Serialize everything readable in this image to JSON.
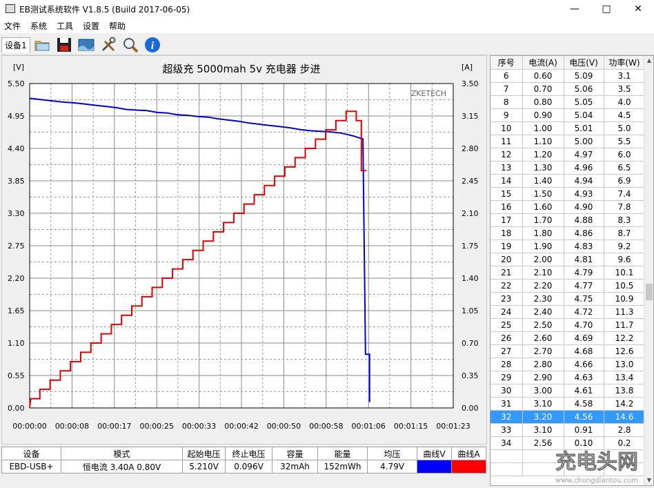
{
  "window": {
    "title": "EB测试系统软件 V1.8.5 (Build 2017-06-05)",
    "minimize": "—",
    "maximize": "□",
    "close": "✕"
  },
  "menu": [
    "文件",
    "系统",
    "工具",
    "设置",
    "帮助"
  ],
  "toolbar": {
    "device_tab": "设备1",
    "icons": [
      "folder-icon",
      "save-icon",
      "image-icon",
      "tools-icon",
      "search-icon",
      "info-icon"
    ]
  },
  "chart_data": {
    "type": "line",
    "title": "超级充  5000mah  5v 充电器 步进",
    "watermark": "ZKETECH",
    "left_axis_unit": "[V]",
    "right_axis_unit": "[A]",
    "ylim_left": [
      0,
      5.5
    ],
    "ylim_right": [
      0,
      3.5
    ],
    "left_ticks": [
      "5.50",
      "4.95",
      "4.40",
      "3.85",
      "3.30",
      "2.75",
      "2.20",
      "1.65",
      "1.10",
      "0.55",
      "0.00"
    ],
    "right_ticks": [
      "3.50",
      "3.15",
      "2.80",
      "2.45",
      "2.10",
      "1.75",
      "1.40",
      "1.05",
      "0.70",
      "0.35",
      "0.00"
    ],
    "x_ticks": [
      "00:00:00",
      "00:00:08",
      "00:00:17",
      "00:00:25",
      "00:00:33",
      "00:00:42",
      "00:00:50",
      "00:00:58",
      "00:01:06",
      "00:01:15",
      "00:01:23"
    ],
    "x_range_seconds": [
      0,
      83
    ],
    "grid": true,
    "series": [
      {
        "name": "曲线V",
        "axis": "left",
        "color": "#0000cc",
        "points": [
          [
            0,
            5.25
          ],
          [
            2,
            5.23
          ],
          [
            4,
            5.21
          ],
          [
            6,
            5.19
          ],
          [
            9,
            5.17
          ],
          [
            11,
            5.15
          ],
          [
            13,
            5.13
          ],
          [
            15,
            5.11
          ],
          [
            17,
            5.09
          ],
          [
            19,
            5.06
          ],
          [
            21,
            5.05
          ],
          [
            23,
            5.04
          ],
          [
            25,
            5.01
          ],
          [
            27,
            5.0
          ],
          [
            29,
            4.97
          ],
          [
            31,
            4.96
          ],
          [
            33,
            4.94
          ],
          [
            35,
            4.93
          ],
          [
            37,
            4.9
          ],
          [
            39,
            4.88
          ],
          [
            41,
            4.86
          ],
          [
            43,
            4.83
          ],
          [
            45,
            4.81
          ],
          [
            47,
            4.79
          ],
          [
            49,
            4.77
          ],
          [
            51,
            4.75
          ],
          [
            53,
            4.72
          ],
          [
            55,
            4.7
          ],
          [
            57,
            4.69
          ],
          [
            59,
            4.68
          ],
          [
            61,
            4.66
          ],
          [
            62.5,
            4.63
          ],
          [
            63.5,
            4.61
          ],
          [
            64.5,
            4.58
          ],
          [
            65.3,
            4.56
          ],
          [
            65.8,
            0.91
          ],
          [
            66.6,
            0.91
          ],
          [
            66.6,
            0.1
          ]
        ]
      },
      {
        "name": "曲线A",
        "axis": "right",
        "color": "#dd0000",
        "points": [
          [
            0,
            0.0
          ],
          [
            0.2,
            0.1
          ],
          [
            2,
            0.1
          ],
          [
            2,
            0.2
          ],
          [
            4,
            0.2
          ],
          [
            4,
            0.3
          ],
          [
            6,
            0.3
          ],
          [
            6,
            0.4
          ],
          [
            8,
            0.4
          ],
          [
            8,
            0.5
          ],
          [
            10,
            0.5
          ],
          [
            10,
            0.6
          ],
          [
            12,
            0.6
          ],
          [
            12,
            0.7
          ],
          [
            14,
            0.7
          ],
          [
            14,
            0.8
          ],
          [
            16,
            0.8
          ],
          [
            16,
            0.9
          ],
          [
            18,
            0.9
          ],
          [
            18,
            1.0
          ],
          [
            20,
            1.0
          ],
          [
            20,
            1.1
          ],
          [
            22,
            1.1
          ],
          [
            22,
            1.2
          ],
          [
            24,
            1.2
          ],
          [
            24,
            1.3
          ],
          [
            26,
            1.3
          ],
          [
            26,
            1.4
          ],
          [
            28,
            1.4
          ],
          [
            28,
            1.5
          ],
          [
            30,
            1.5
          ],
          [
            30,
            1.6
          ],
          [
            32,
            1.6
          ],
          [
            32,
            1.7
          ],
          [
            34,
            1.7
          ],
          [
            34,
            1.8
          ],
          [
            36,
            1.8
          ],
          [
            36,
            1.9
          ],
          [
            38,
            1.9
          ],
          [
            38,
            2.0
          ],
          [
            40,
            2.0
          ],
          [
            40,
            2.1
          ],
          [
            42,
            2.1
          ],
          [
            42,
            2.2
          ],
          [
            44,
            2.2
          ],
          [
            44,
            2.3
          ],
          [
            46,
            2.3
          ],
          [
            46,
            2.4
          ],
          [
            48,
            2.4
          ],
          [
            48,
            2.5
          ],
          [
            50,
            2.5
          ],
          [
            50,
            2.6
          ],
          [
            52,
            2.6
          ],
          [
            52,
            2.7
          ],
          [
            54,
            2.7
          ],
          [
            54,
            2.8
          ],
          [
            56,
            2.8
          ],
          [
            56,
            2.9
          ],
          [
            58,
            2.9
          ],
          [
            58,
            3.0
          ],
          [
            60,
            3.0
          ],
          [
            60,
            3.1
          ],
          [
            62,
            3.1
          ],
          [
            62,
            3.2
          ],
          [
            64,
            3.2
          ],
          [
            64,
            3.1
          ],
          [
            65,
            3.1
          ],
          [
            65,
            2.56
          ],
          [
            66,
            2.56
          ]
        ]
      }
    ]
  },
  "table": {
    "headers": [
      "序号",
      "电流(A)",
      "电压(V)",
      "功率(W)"
    ],
    "selected_index": "32",
    "rows": [
      [
        "6",
        "0.60",
        "5.09",
        "3.1"
      ],
      [
        "7",
        "0.70",
        "5.06",
        "3.5"
      ],
      [
        "8",
        "0.80",
        "5.05",
        "4.0"
      ],
      [
        "9",
        "0.90",
        "5.04",
        "4.5"
      ],
      [
        "10",
        "1.00",
        "5.01",
        "5.0"
      ],
      [
        "11",
        "1.10",
        "5.00",
        "5.5"
      ],
      [
        "12",
        "1.20",
        "4.97",
        "6.0"
      ],
      [
        "13",
        "1.30",
        "4.96",
        "6.5"
      ],
      [
        "14",
        "1.40",
        "4.94",
        "6.9"
      ],
      [
        "15",
        "1.50",
        "4.93",
        "7.4"
      ],
      [
        "16",
        "1.60",
        "4.90",
        "7.8"
      ],
      [
        "17",
        "1.70",
        "4.88",
        "8.3"
      ],
      [
        "18",
        "1.80",
        "4.86",
        "8.7"
      ],
      [
        "19",
        "1.90",
        "4.83",
        "9.2"
      ],
      [
        "20",
        "2.00",
        "4.81",
        "9.6"
      ],
      [
        "21",
        "2.10",
        "4.79",
        "10.1"
      ],
      [
        "22",
        "2.20",
        "4.77",
        "10.5"
      ],
      [
        "23",
        "2.30",
        "4.75",
        "10.9"
      ],
      [
        "24",
        "2.40",
        "4.72",
        "11.3"
      ],
      [
        "25",
        "2.50",
        "4.70",
        "11.7"
      ],
      [
        "26",
        "2.60",
        "4.69",
        "12.2"
      ],
      [
        "27",
        "2.70",
        "4.68",
        "12.6"
      ],
      [
        "28",
        "2.80",
        "4.66",
        "13.0"
      ],
      [
        "29",
        "2.90",
        "4.63",
        "13.4"
      ],
      [
        "30",
        "3.00",
        "4.61",
        "13.8"
      ],
      [
        "31",
        "3.10",
        "4.58",
        "14.2"
      ],
      [
        "32",
        "3.20",
        "4.56",
        "14.6"
      ],
      [
        "33",
        "3.10",
        "0.91",
        "2.8"
      ],
      [
        "34",
        "2.56",
        "0.10",
        "0.2"
      ]
    ]
  },
  "bottom": {
    "headers": [
      "设备",
      "模式",
      "起始电压",
      "终止电压",
      "容量",
      "能量",
      "均压",
      "曲线V",
      "曲线A"
    ],
    "values": [
      "EBD-USB+",
      "恒电流  3.40A  0.80V",
      "5.210V",
      "0.096V",
      "32mAh",
      "152mWh",
      "4.79V",
      "",
      ""
    ],
    "swatch_v": "#0000ff",
    "swatch_a": "#ff0000"
  },
  "site_watermark": {
    "logo": "充电头网",
    "url": "www.chongdiantou.com"
  }
}
